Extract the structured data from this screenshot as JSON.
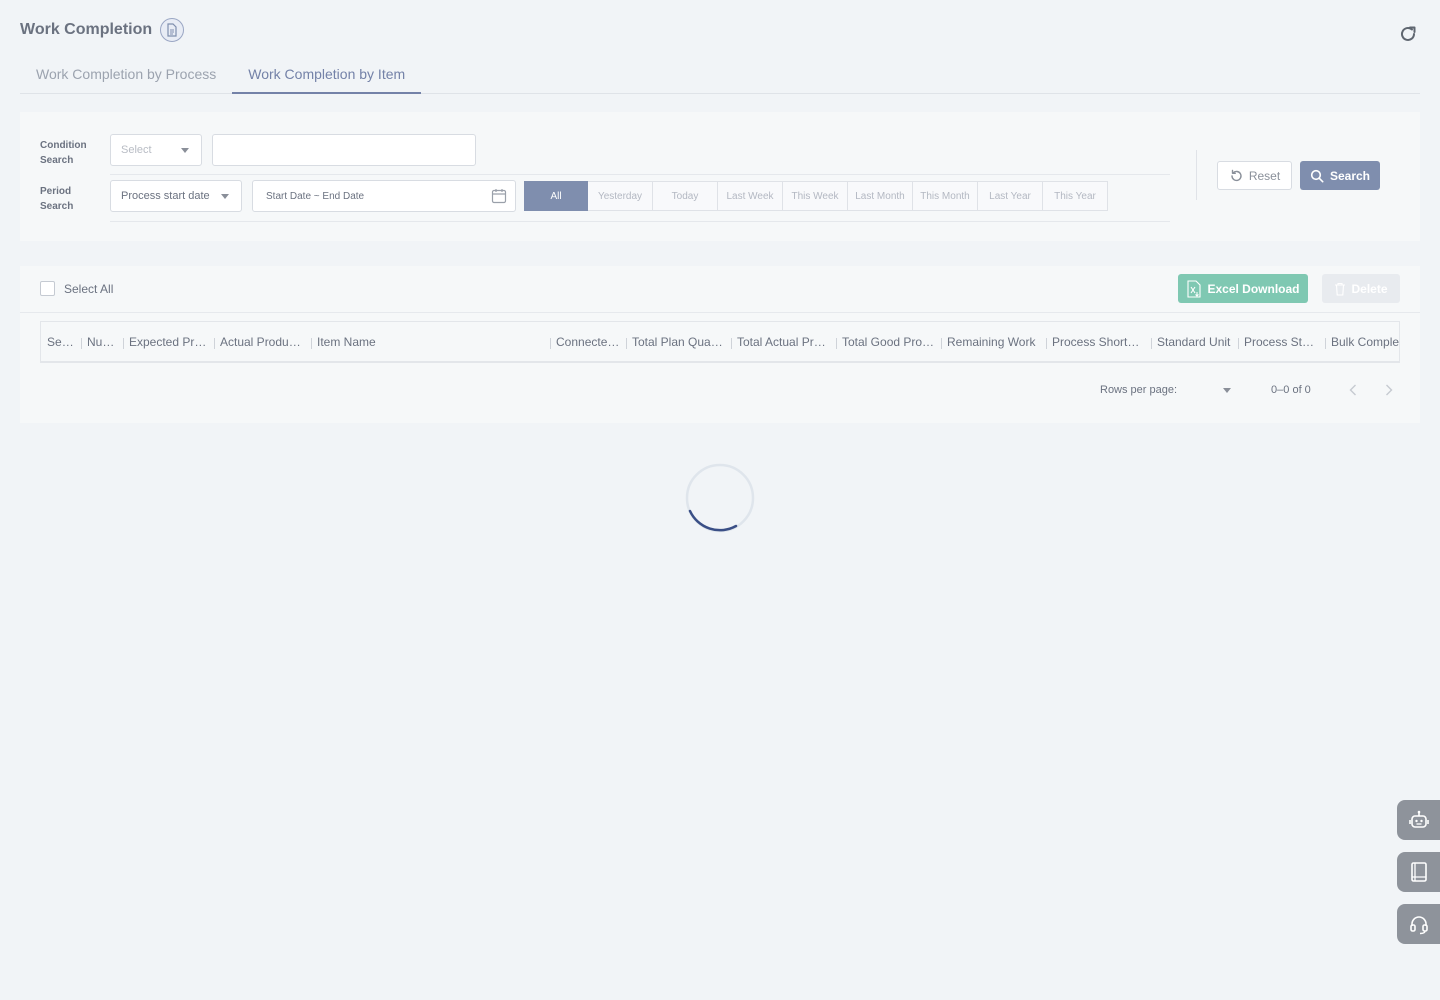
{
  "page": {
    "title": "Work Completion"
  },
  "tabs": [
    {
      "label": "Work Completion by Process",
      "active": false
    },
    {
      "label": "Work Completion by Item",
      "active": true
    }
  ],
  "search": {
    "condition_label_1": "Condition",
    "condition_label_2": "Search",
    "condition_select": "Select",
    "condition_input_value": "",
    "period_label_1": "Period",
    "period_label_2": "Search",
    "period_select": "Process start date",
    "date_range_placeholder": "Start Date ~ End Date",
    "period_buttons": [
      "All",
      "Yesterday",
      "Today",
      "Last Week",
      "This Week",
      "Last Month",
      "This Month",
      "Last Year",
      "This Year"
    ],
    "period_active": "All",
    "reset_label": "Reset",
    "search_label": "Search"
  },
  "list": {
    "select_all_label": "Select All",
    "excel_label": "Excel Download",
    "delete_label": "Delete",
    "columns": [
      "Selection",
      "Number",
      "Expected Production Date",
      "Actual Production Date",
      "Item Name",
      "Connected Order",
      "Total Plan Quantity",
      "Total Actual Production",
      "Total Good Production",
      "Remaining Work",
      "Process Shortage",
      "Standard Unit",
      "Process Status",
      "Bulk Complete"
    ],
    "rows_per_page_label": "Rows per page:",
    "rows_per_page_value": "",
    "range_text": "0–0 of 0"
  },
  "colors": {
    "accent": "#7f8eae",
    "excel": "#7fc8b2",
    "background": "#f1f4f7",
    "panel": "#f6f8f9"
  },
  "icons": {
    "title": "document-icon",
    "refresh": "refresh-icon",
    "calendar": "calendar-icon",
    "reset": "undo-icon",
    "search": "magnifier-icon",
    "excel": "excel-file-icon",
    "delete": "trash-icon",
    "side": [
      "robot-icon",
      "book-icon",
      "headset-icon"
    ]
  }
}
